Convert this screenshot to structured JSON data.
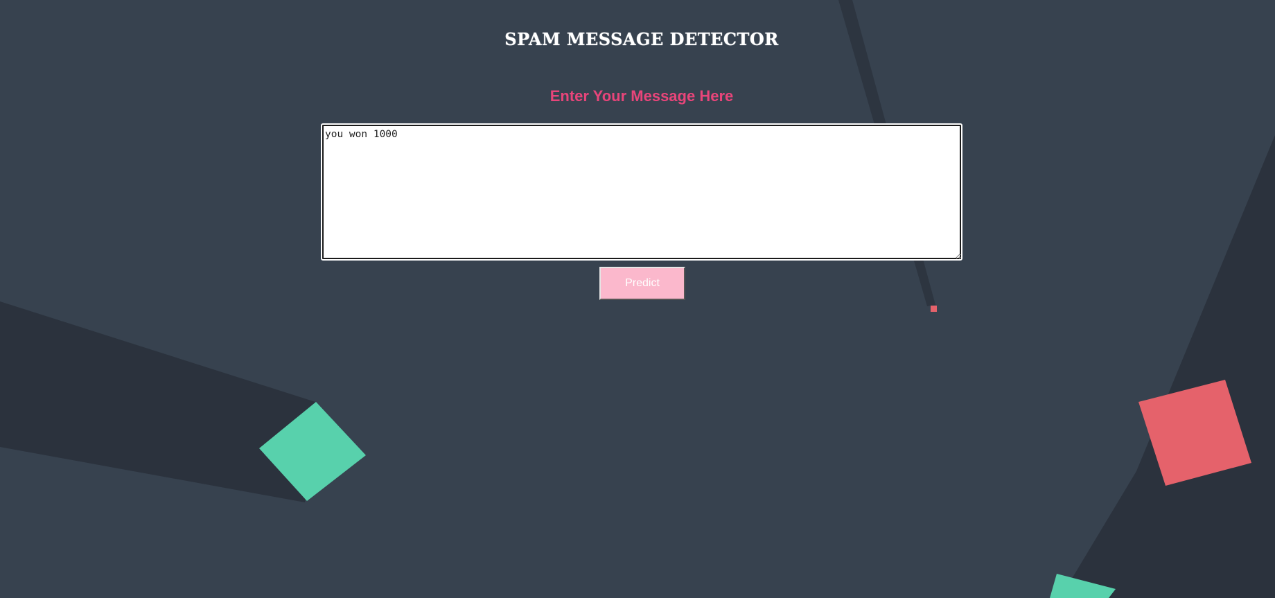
{
  "header": {
    "title": "SPAM MESSAGE DETECTOR"
  },
  "form": {
    "prompt_label": "Enter Your Message Here",
    "message_value": "you won 1000",
    "predict_label": "Predict"
  },
  "colors": {
    "background": "#37424f",
    "shadow": "#2b323d",
    "accent_pink": "#e8457a",
    "button_bg": "#fbb8cc",
    "shape_teal": "#58d1ac",
    "shape_red": "#e5626b"
  }
}
